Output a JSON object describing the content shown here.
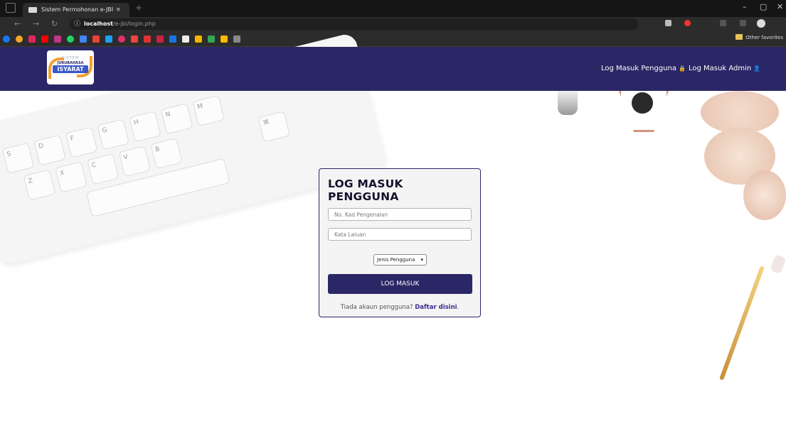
{
  "browser": {
    "tab_title": "Sistem Permohonan e-JBI",
    "tab_close": "×",
    "new_tab": "+",
    "url_host": "localhost",
    "url_path": "/e-jbi/login.php",
    "other_favorites": "Other favorites",
    "minimize": "–",
    "maximize": "▢",
    "close": "✕"
  },
  "header": {
    "logo": {
      "line1": "SISTEM",
      "line2": "JURUBAHASA",
      "line3": "ISYARAT"
    },
    "nav": [
      {
        "label": "Log Masuk Pengguna",
        "icon": "lock-icon",
        "glyph": "🔒"
      },
      {
        "label": "Log Masuk Admin",
        "icon": "user-icon",
        "glyph": "👤"
      }
    ]
  },
  "login": {
    "title": "LOG MASUK PENGGUNA",
    "ic_placeholder": "No. Kad Pengenalan",
    "password_placeholder": "Kata Laluan",
    "user_type_selected": "Jenis Pengguna",
    "submit_label": "LOG MASUK",
    "signup_prompt": "Tiada akaun pengguna?",
    "signup_link": "Daftar disini",
    "signup_suffix": "."
  },
  "keyboard_keys": [
    "S",
    "D",
    "F",
    "G",
    "H",
    "N",
    "M",
    "Z",
    "X",
    "C",
    "V",
    "B",
    "⌘"
  ],
  "colors": {
    "primary": "#2b2766",
    "link": "#3d2a8c",
    "accent": "#f0a032"
  }
}
